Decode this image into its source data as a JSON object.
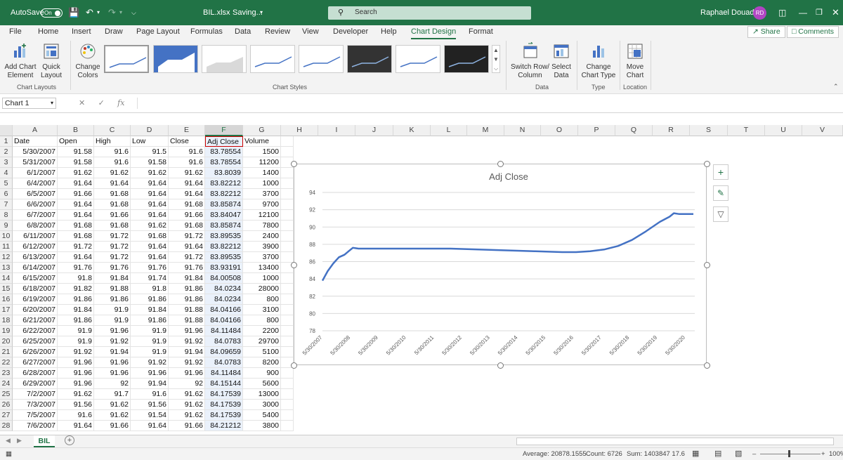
{
  "titlebar": {
    "autosave_label": "AutoSave",
    "autosave_state": "On",
    "filename": "BIL.xlsx",
    "save_status": "Saving...",
    "search_placeholder": "Search",
    "user_name": "Raphael Douady",
    "user_initials": "RD"
  },
  "menu": {
    "tabs": [
      "File",
      "Home",
      "Insert",
      "Draw",
      "Page Layout",
      "Formulas",
      "Data",
      "Review",
      "View",
      "Developer",
      "Help",
      "Chart Design",
      "Format"
    ],
    "active_tab": "Chart Design",
    "share_label": "Share",
    "comments_label": "Comments"
  },
  "ribbon": {
    "add_chart_element": "Add Chart Element",
    "quick_layout": "Quick Layout",
    "change_colors": "Change Colors",
    "chart_layouts_group": "Chart Layouts",
    "chart_styles_group": "Chart Styles",
    "switch_row_column": "Switch Row/ Column",
    "select_data": "Select Data",
    "data_group": "Data",
    "change_chart_type": "Change Chart Type",
    "type_group": "Type",
    "move_chart": "Move Chart",
    "location_group": "Location"
  },
  "formula_bar": {
    "name_box": "Chart 1",
    "fx": "fx",
    "content": ""
  },
  "columns": [
    "A",
    "B",
    "C",
    "D",
    "E",
    "F",
    "G",
    "H",
    "I",
    "J",
    "K",
    "L",
    "M",
    "N",
    "O",
    "P",
    "Q",
    "R",
    "S",
    "T",
    "U",
    "V"
  ],
  "headers": [
    "Date",
    "Open",
    "High",
    "Low",
    "Close",
    "Adj Close",
    "Volume"
  ],
  "rows": [
    [
      "5/30/2007",
      "91.58",
      "91.6",
      "91.5",
      "91.6",
      "83.78554",
      "1500"
    ],
    [
      "5/31/2007",
      "91.58",
      "91.6",
      "91.58",
      "91.6",
      "83.78554",
      "11200"
    ],
    [
      "6/1/2007",
      "91.62",
      "91.62",
      "91.62",
      "91.62",
      "83.8039",
      "1400"
    ],
    [
      "6/4/2007",
      "91.64",
      "91.64",
      "91.64",
      "91.64",
      "83.82212",
      "1000"
    ],
    [
      "6/5/2007",
      "91.66",
      "91.68",
      "91.64",
      "91.64",
      "83.82212",
      "3700"
    ],
    [
      "6/6/2007",
      "91.64",
      "91.68",
      "91.64",
      "91.68",
      "83.85874",
      "9700"
    ],
    [
      "6/7/2007",
      "91.64",
      "91.66",
      "91.64",
      "91.66",
      "83.84047",
      "12100"
    ],
    [
      "6/8/2007",
      "91.68",
      "91.68",
      "91.62",
      "91.68",
      "83.85874",
      "7800"
    ],
    [
      "6/11/2007",
      "91.68",
      "91.72",
      "91.68",
      "91.72",
      "83.89535",
      "2400"
    ],
    [
      "6/12/2007",
      "91.72",
      "91.72",
      "91.64",
      "91.64",
      "83.82212",
      "3900"
    ],
    [
      "6/13/2007",
      "91.64",
      "91.72",
      "91.64",
      "91.72",
      "83.89535",
      "3700"
    ],
    [
      "6/14/2007",
      "91.76",
      "91.76",
      "91.76",
      "91.76",
      "83.93191",
      "13400"
    ],
    [
      "6/15/2007",
      "91.8",
      "91.84",
      "91.74",
      "91.84",
      "84.00508",
      "1000"
    ],
    [
      "6/18/2007",
      "91.82",
      "91.88",
      "91.8",
      "91.86",
      "84.0234",
      "28000"
    ],
    [
      "6/19/2007",
      "91.86",
      "91.86",
      "91.86",
      "91.86",
      "84.0234",
      "800"
    ],
    [
      "6/20/2007",
      "91.84",
      "91.9",
      "91.84",
      "91.88",
      "84.04166",
      "3100"
    ],
    [
      "6/21/2007",
      "91.86",
      "91.9",
      "91.86",
      "91.88",
      "84.04166",
      "800"
    ],
    [
      "6/22/2007",
      "91.9",
      "91.96",
      "91.9",
      "91.96",
      "84.11484",
      "2200"
    ],
    [
      "6/25/2007",
      "91.9",
      "91.92",
      "91.9",
      "91.92",
      "84.0783",
      "29700"
    ],
    [
      "6/26/2007",
      "91.92",
      "91.94",
      "91.9",
      "91.94",
      "84.09659",
      "5100"
    ],
    [
      "6/27/2007",
      "91.96",
      "91.96",
      "91.92",
      "91.92",
      "84.0783",
      "8200"
    ],
    [
      "6/28/2007",
      "91.96",
      "91.96",
      "91.96",
      "91.96",
      "84.11484",
      "900"
    ],
    [
      "6/29/2007",
      "91.96",
      "92",
      "91.94",
      "92",
      "84.15144",
      "5600"
    ],
    [
      "7/2/2007",
      "91.62",
      "91.7",
      "91.6",
      "91.62",
      "84.17539",
      "13000"
    ],
    [
      "7/3/2007",
      "91.56",
      "91.62",
      "91.56",
      "91.62",
      "84.17539",
      "3000"
    ],
    [
      "7/5/2007",
      "91.6",
      "91.62",
      "91.54",
      "91.62",
      "84.17539",
      "5400"
    ],
    [
      "7/6/2007",
      "91.64",
      "91.66",
      "91.64",
      "91.66",
      "84.21212",
      "3800"
    ]
  ],
  "chart_data": {
    "type": "line",
    "title": "Adj Close",
    "ylim": [
      78,
      94
    ],
    "yticks": [
      78,
      80,
      82,
      84,
      86,
      88,
      90,
      92,
      94
    ],
    "xticks": [
      "5/30/2007",
      "5/30/2008",
      "5/30/2009",
      "5/30/2010",
      "5/30/2011",
      "5/30/2012",
      "5/30/2013",
      "5/30/2014",
      "5/30/2015",
      "5/30/2016",
      "5/30/2017",
      "5/30/2018",
      "5/30/2019",
      "5/30/2020"
    ],
    "series": [
      {
        "color": "#4472c4",
        "x": [
          2007.41,
          2007.6,
          2007.8,
          2008.0,
          2008.2,
          2008.35,
          2008.5,
          2008.7,
          2009.0,
          2009.5,
          2010.0,
          2011.0,
          2012.0,
          2013.0,
          2014.0,
          2015.0,
          2016.0,
          2016.5,
          2017.0,
          2017.5,
          2018.0,
          2018.5,
          2019.0,
          2019.5,
          2019.85,
          2020.0,
          2020.2,
          2020.5,
          2020.7
        ],
        "y": [
          83.8,
          84.9,
          85.8,
          86.5,
          86.8,
          87.2,
          87.6,
          87.5,
          87.5,
          87.5,
          87.5,
          87.5,
          87.5,
          87.4,
          87.3,
          87.2,
          87.1,
          87.1,
          87.2,
          87.4,
          87.8,
          88.5,
          89.5,
          90.6,
          91.2,
          91.6,
          91.5,
          91.5,
          91.5
        ]
      }
    ],
    "grid": true,
    "legend": "none"
  },
  "statusbar": {
    "average": "Average: 20878.1555",
    "count": "Count: 6726",
    "sum": "Sum: 1403847 17.6",
    "zoom": "100%"
  },
  "sheet": {
    "tab_name": "BIL"
  }
}
